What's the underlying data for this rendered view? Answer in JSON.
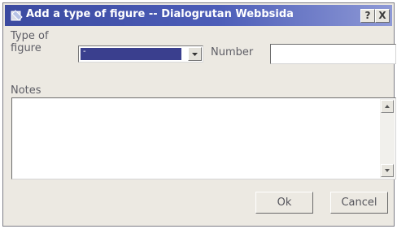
{
  "window": {
    "title": "Add a type of figure -- Dialogrutan Webbsida",
    "help_label": "?",
    "close_label": "X"
  },
  "form": {
    "type_label": "Type of figure",
    "type_value": "-",
    "number_label": "Number",
    "number_value": "",
    "notes_label": "Notes",
    "notes_value": ""
  },
  "buttons": {
    "ok_label": "Ok",
    "cancel_label": "Cancel"
  },
  "colors": {
    "titlebar": "#3b4aa0",
    "selection": "#3a3f8e",
    "window_bg": "#ece9e2"
  },
  "icons": {
    "app": "dialog-app-icon",
    "dropdown": "chevron-down-icon",
    "scroll_up": "arrow-up-icon",
    "scroll_down": "arrow-down-icon"
  }
}
